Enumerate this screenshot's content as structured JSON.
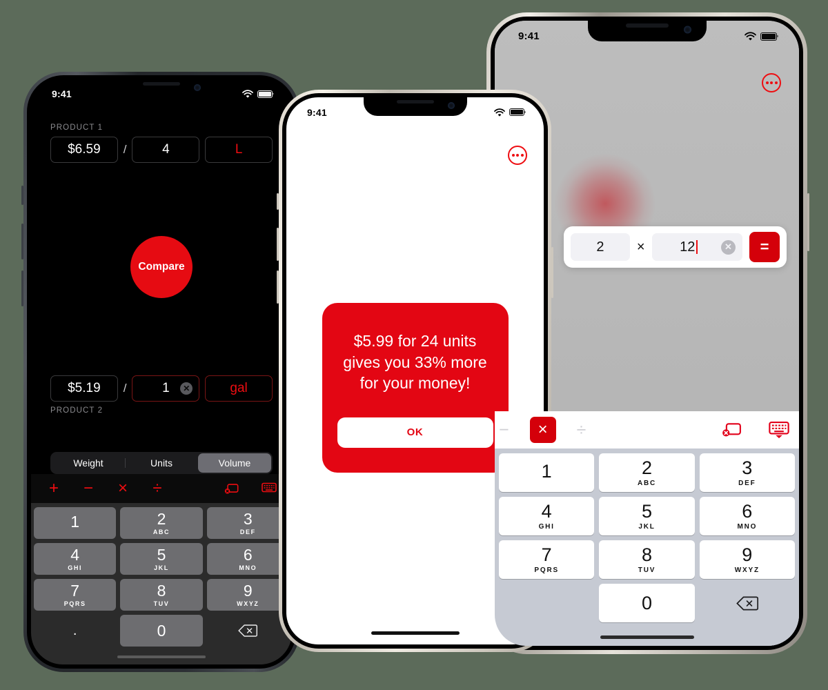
{
  "app": {
    "accent_red": "#e30613",
    "page_background": "#5c6b5a"
  },
  "phone_left": {
    "status": {
      "time": "9:41",
      "wifi_icon": "wifi-icon",
      "battery_icon": "battery-icon"
    },
    "product1": {
      "label": "PRODUCT 1",
      "price": "$6.59",
      "divider": "/",
      "quantity": "4",
      "unit": "L"
    },
    "compare_button": "Compare",
    "product2": {
      "label": "PRODUCT 2",
      "price": "$5.19",
      "divider": "/",
      "quantity": "1",
      "unit": "gal",
      "clear_icon": "clear-circle-icon"
    },
    "segmented": {
      "options": [
        "Weight",
        "Units",
        "Volume"
      ],
      "selected": "Volume"
    },
    "keyboard_toolbar": {
      "operators": [
        "+",
        "−",
        "×",
        "÷"
      ],
      "clear_field_icon": "clear-field-icon",
      "dismiss_keyboard_icon": "keyboard-dismiss-icon"
    },
    "keypad": [
      {
        "num": "1",
        "sub": ""
      },
      {
        "num": "2",
        "sub": "ABC"
      },
      {
        "num": "3",
        "sub": "DEF"
      },
      {
        "num": "4",
        "sub": "GHI"
      },
      {
        "num": "5",
        "sub": "JKL"
      },
      {
        "num": "6",
        "sub": "MNO"
      },
      {
        "num": "7",
        "sub": "PQRS"
      },
      {
        "num": "8",
        "sub": "TUV"
      },
      {
        "num": "9",
        "sub": "WXYZ"
      },
      {
        "num": ".",
        "sub": ""
      },
      {
        "num": "0",
        "sub": ""
      },
      {
        "num": "",
        "sub": ""
      }
    ],
    "backspace_icon": "backspace-icon"
  },
  "phone_center": {
    "status": {
      "time": "9:41",
      "wifi_icon": "wifi-icon",
      "battery_icon": "battery-icon"
    },
    "more_icon": "more-options-icon",
    "alert": {
      "message": "$5.99 for 24 units gives you 33% more for your money!",
      "ok_label": "OK"
    }
  },
  "phone_right": {
    "status": {
      "time": "9:41",
      "wifi_icon": "wifi-icon",
      "battery_icon": "battery-icon"
    },
    "more_icon": "more-options-icon",
    "calc_bar": {
      "operand_a": "2",
      "operator": "×",
      "operand_b": "12",
      "clear_icon": "clear-circle-icon",
      "equals_label": "="
    },
    "keyboard_toolbar": {
      "minus": "−",
      "selected_operator": "×",
      "divide": "÷",
      "clear_field_icon": "clear-field-icon",
      "dismiss_keyboard_icon": "keyboard-dismiss-icon"
    },
    "keypad": [
      {
        "num": "1",
        "sub": ""
      },
      {
        "num": "2",
        "sub": "ABC"
      },
      {
        "num": "3",
        "sub": "DEF"
      },
      {
        "num": "4",
        "sub": "GHI"
      },
      {
        "num": "5",
        "sub": "JKL"
      },
      {
        "num": "6",
        "sub": "MNO"
      },
      {
        "num": "7",
        "sub": "PQRS"
      },
      {
        "num": "8",
        "sub": "TUV"
      },
      {
        "num": "9",
        "sub": "WXYZ"
      },
      {
        "num": "",
        "sub": ""
      },
      {
        "num": "0",
        "sub": ""
      },
      {
        "num": "",
        "sub": ""
      }
    ],
    "backspace_icon": "backspace-icon"
  }
}
